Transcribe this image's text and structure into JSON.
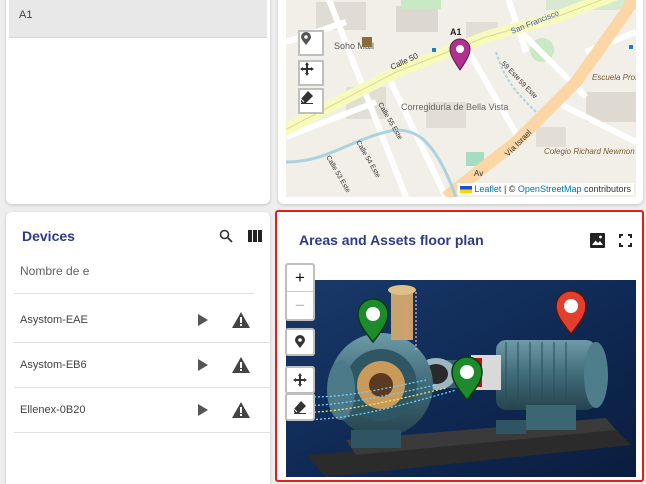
{
  "locations_card": {
    "selected_item": "A1"
  },
  "map": {
    "labels": {
      "soho_mall": "Soho Mall",
      "a1": "A1",
      "calle_50": "Calle 50",
      "san_francisco": "San Francisco",
      "corregiduria": "Corregiduría de Bella Vista",
      "calle_55": "Calle 55 Este",
      "calle_54": "Calle 54 Este",
      "calle_53": "Calle 53 Este",
      "st_59a": "59 Este",
      "st_59b": "59 Este",
      "via_israel": "Vía Israel",
      "escuela": "Escuela Profesional Isabel Herrera Obaldía",
      "colegio": "Colegio Richard Newmon",
      "av": "Av"
    },
    "attribution": {
      "leaflet": "Leaflet",
      "sep": " | © ",
      "osm": "OpenStreetMap",
      "suffix": " contributors"
    },
    "marker_color": "#b0318f"
  },
  "devices": {
    "title": "Devices",
    "filter_placeholder": "Nombre de e",
    "rows": [
      {
        "name": "Asystom-EAE"
      },
      {
        "name": "Asystom-EB6"
      },
      {
        "name": "Ellenex-0B20"
      }
    ]
  },
  "floor_plan": {
    "title": "Areas and Assets floor plan",
    "zoom_in": "+",
    "zoom_out": "−",
    "markers": [
      {
        "color": "#1d8a2c",
        "status": "ok"
      },
      {
        "color": "#e2402f",
        "status": "alarm"
      },
      {
        "color": "#1d8a2c",
        "status": "ok"
      }
    ]
  },
  "colors": {
    "accent_title": "#2e3a87",
    "highlight_border": "#e01e1e"
  }
}
